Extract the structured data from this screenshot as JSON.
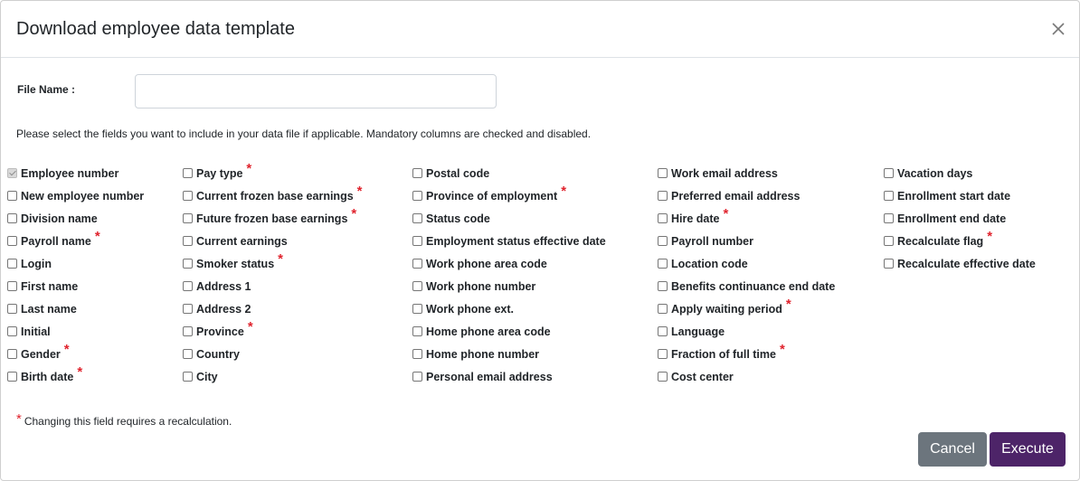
{
  "dialog": {
    "title": "Download employee data template",
    "file_name_label": "File Name :",
    "file_name_value": "",
    "instructions": "Please select the fields you want to include in your data file if applicable. Mandatory columns are checked and disabled.",
    "footnote": "Changing this field requires a recalculation.",
    "footnote_star": "*",
    "cancel_label": "Cancel",
    "execute_label": "Execute",
    "accent_color": "#4d2468",
    "star_color": "#e0232d"
  },
  "icons": {
    "close": "close-icon"
  },
  "columns": [
    [
      {
        "label": "Employee number",
        "checked": true,
        "disabled": true,
        "star": ""
      },
      {
        "label": "New employee number",
        "checked": false,
        "disabled": false,
        "star": ""
      },
      {
        "label": "Division name",
        "checked": false,
        "disabled": false,
        "star": ""
      },
      {
        "label": "Payroll name",
        "checked": false,
        "disabled": false,
        "star": "*"
      },
      {
        "label": "Login",
        "checked": false,
        "disabled": false,
        "star": ""
      },
      {
        "label": "First name",
        "checked": false,
        "disabled": false,
        "star": ""
      },
      {
        "label": "Last name",
        "checked": false,
        "disabled": false,
        "star": ""
      },
      {
        "label": "Initial",
        "checked": false,
        "disabled": false,
        "star": ""
      },
      {
        "label": "Gender",
        "checked": false,
        "disabled": false,
        "star": "*"
      },
      {
        "label": "Birth date",
        "checked": false,
        "disabled": false,
        "star": "*"
      }
    ],
    [
      {
        "label": "Pay type",
        "checked": false,
        "disabled": false,
        "star": "*"
      },
      {
        "label": "Current frozen base earnings",
        "checked": false,
        "disabled": false,
        "star": "*"
      },
      {
        "label": "Future frozen base earnings",
        "checked": false,
        "disabled": false,
        "star": "*"
      },
      {
        "label": "Current earnings",
        "checked": false,
        "disabled": false,
        "star": ""
      },
      {
        "label": "Smoker status",
        "checked": false,
        "disabled": false,
        "star": "*"
      },
      {
        "label": "Address 1",
        "checked": false,
        "disabled": false,
        "star": ""
      },
      {
        "label": "Address 2",
        "checked": false,
        "disabled": false,
        "star": ""
      },
      {
        "label": "Province",
        "checked": false,
        "disabled": false,
        "star": "*"
      },
      {
        "label": "Country",
        "checked": false,
        "disabled": false,
        "star": ""
      },
      {
        "label": "City",
        "checked": false,
        "disabled": false,
        "star": ""
      }
    ],
    [
      {
        "label": "Postal code",
        "checked": false,
        "disabled": false,
        "star": ""
      },
      {
        "label": "Province of employment",
        "checked": false,
        "disabled": false,
        "star": "*"
      },
      {
        "label": "Status code",
        "checked": false,
        "disabled": false,
        "star": ""
      },
      {
        "label": "Employment status effective date",
        "checked": false,
        "disabled": false,
        "star": ""
      },
      {
        "label": "Work phone area code",
        "checked": false,
        "disabled": false,
        "star": ""
      },
      {
        "label": "Work phone number",
        "checked": false,
        "disabled": false,
        "star": ""
      },
      {
        "label": "Work phone ext.",
        "checked": false,
        "disabled": false,
        "star": ""
      },
      {
        "label": "Home phone area code",
        "checked": false,
        "disabled": false,
        "star": ""
      },
      {
        "label": "Home phone number",
        "checked": false,
        "disabled": false,
        "star": ""
      },
      {
        "label": "Personal email address",
        "checked": false,
        "disabled": false,
        "star": ""
      }
    ],
    [
      {
        "label": "Work email address",
        "checked": false,
        "disabled": false,
        "star": ""
      },
      {
        "label": "Preferred email address",
        "checked": false,
        "disabled": false,
        "star": ""
      },
      {
        "label": "Hire date",
        "checked": false,
        "disabled": false,
        "star": "*"
      },
      {
        "label": "Payroll number",
        "checked": false,
        "disabled": false,
        "star": ""
      },
      {
        "label": "Location code",
        "checked": false,
        "disabled": false,
        "star": ""
      },
      {
        "label": "Benefits continuance end date",
        "checked": false,
        "disabled": false,
        "star": ""
      },
      {
        "label": "Apply waiting period",
        "checked": false,
        "disabled": false,
        "star": "*"
      },
      {
        "label": "Language",
        "checked": false,
        "disabled": false,
        "star": ""
      },
      {
        "label": "Fraction of full time",
        "checked": false,
        "disabled": false,
        "star": "*"
      },
      {
        "label": "Cost center",
        "checked": false,
        "disabled": false,
        "star": ""
      }
    ],
    [
      {
        "label": "Vacation days",
        "checked": false,
        "disabled": false,
        "star": ""
      },
      {
        "label": "Enrollment start date",
        "checked": false,
        "disabled": false,
        "star": ""
      },
      {
        "label": "Enrollment end date",
        "checked": false,
        "disabled": false,
        "star": ""
      },
      {
        "label": "Recalculate flag",
        "checked": false,
        "disabled": false,
        "star": "*"
      },
      {
        "label": "Recalculate effective date",
        "checked": false,
        "disabled": false,
        "star": ""
      }
    ]
  ]
}
